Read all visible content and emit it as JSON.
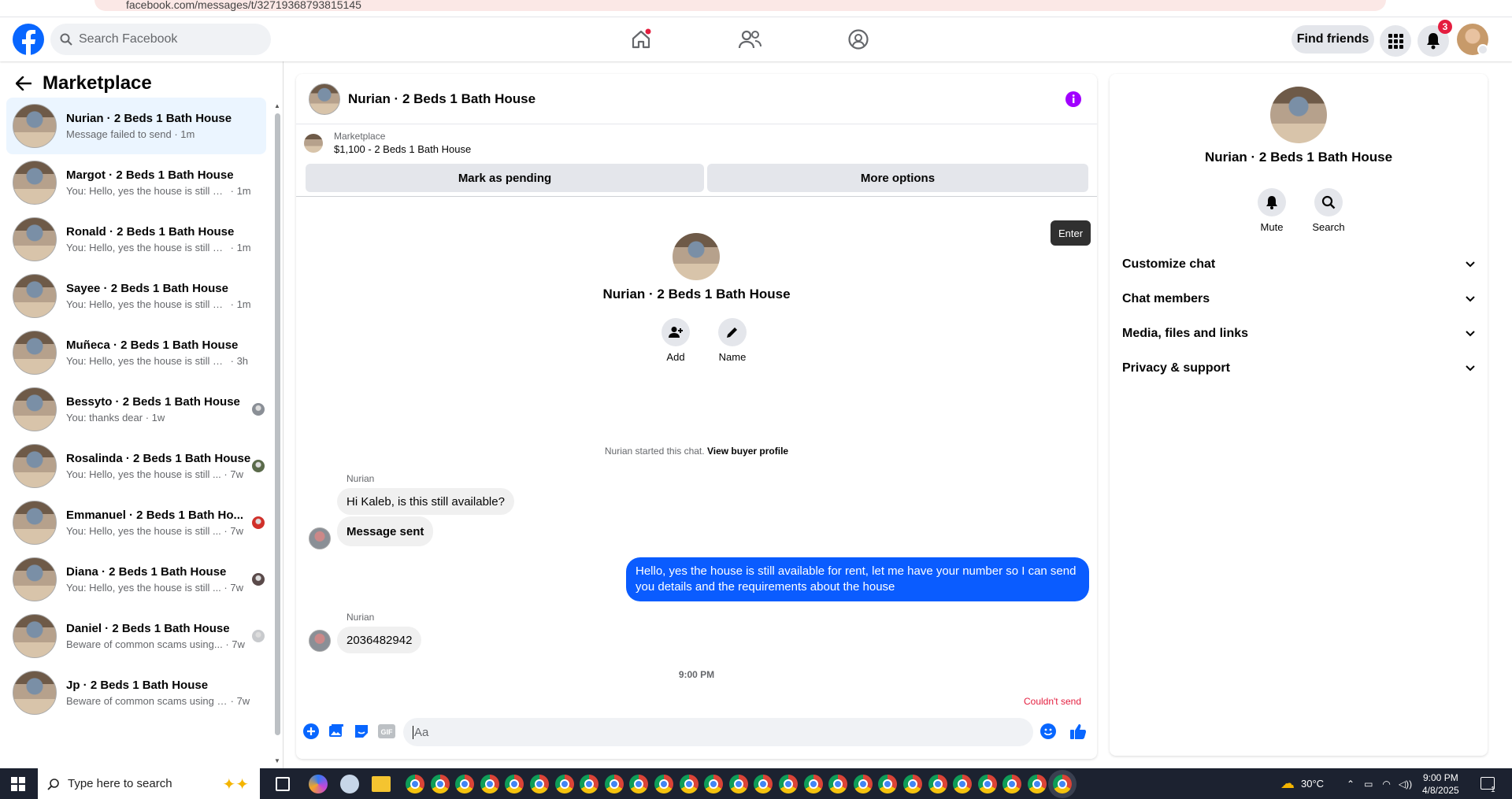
{
  "browser": {
    "url": "facebook.com/messages/t/32719368793815145"
  },
  "header": {
    "search_placeholder": "Search Facebook",
    "find_friends": "Find friends",
    "notifications_count": "3",
    "brand_color": "#0866ff"
  },
  "sidebar": {
    "title": "Marketplace",
    "conversations": [
      {
        "name": "Nurian · 2 Beds 1 Bath House",
        "preview": "Message failed to send",
        "time": "1m",
        "active": true
      },
      {
        "name": "Margot · 2 Beds 1 Bath House",
        "preview": "You: Hello, yes the house is still av...",
        "time": "1m"
      },
      {
        "name": "Ronald · 2 Beds 1 Bath House",
        "preview": "You: Hello, yes the house is still av...",
        "time": "1m"
      },
      {
        "name": "Sayee · 2 Beds 1 Bath House",
        "preview": "You: Hello, yes the house is still av...",
        "time": "1m"
      },
      {
        "name": "Muñeca · 2 Beds 1 Bath House",
        "preview": "You: Hello, yes the house is still avai...",
        "time": "3h"
      },
      {
        "name": "Bessyto · 2 Beds 1 Bath House",
        "preview": "You: thanks dear",
        "time": "1w"
      },
      {
        "name": "Rosalinda · 2 Beds 1 Bath House",
        "preview": "You: Hello, yes the house is still ...",
        "time": "7w"
      },
      {
        "name": "Emmanuel · 2 Beds 1 Bath Ho...",
        "preview": "You: Hello, yes the house is still ...",
        "time": "7w"
      },
      {
        "name": "Diana · 2 Beds 1 Bath House",
        "preview": "You: Hello, yes the house is still ...",
        "time": "7w"
      },
      {
        "name": "Daniel · 2 Beds 1 Bath House",
        "preview": "Beware of common scams using...",
        "time": "7w"
      },
      {
        "name": "Jp · 2 Beds 1 Bath House",
        "preview": "Beware of common scams using p...",
        "time": "7w"
      }
    ]
  },
  "chat": {
    "title": "Nurian · 2 Beds 1 Bath House",
    "marketplace_label": "Marketplace",
    "listing": "$1,100 - 2 Beds 1 Bath House",
    "mark_pending": "Mark as pending",
    "more_options": "More options",
    "tooltip": "Enter",
    "profile_name": "Nurian · 2 Beds 1 Bath House",
    "add_label": "Add",
    "name_label": "Name",
    "started_text": "Nurian started this chat.",
    "view_profile": "View buyer profile",
    "messages": {
      "sender1": "Nurian",
      "msg1": "Hi Kaleb, is this still available?",
      "msg2": "Message sent",
      "outgoing": "Hello, yes the house is still available for rent, let me have your number so I can send you details and the requirements about the house",
      "sender2": "Nurian",
      "msg3": "2036482942",
      "timestamp": "9:00 PM",
      "failed": "Couldn't send"
    },
    "composer_placeholder": "Aa"
  },
  "details": {
    "name": "Nurian · 2 Beds 1 Bath House",
    "mute": "Mute",
    "search": "Search",
    "sections": [
      "Customize chat",
      "Chat members",
      "Media, files and links",
      "Privacy & support"
    ]
  },
  "taskbar": {
    "search_placeholder": "Type here to search",
    "weather": "30°C",
    "time": "9:00 PM",
    "date": "4/8/2025",
    "notif": "1"
  }
}
